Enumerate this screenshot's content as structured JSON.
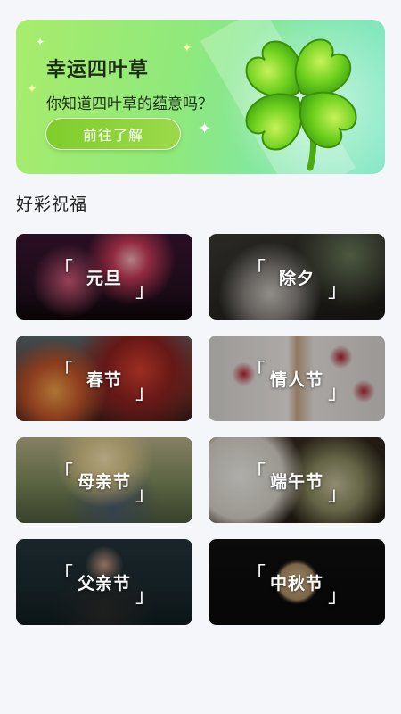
{
  "banner": {
    "title": "幸运四叶草",
    "subtitle": "你知道四叶草的蕴意吗？",
    "button_label": "前往了解"
  },
  "section": {
    "title": "好彩祝福"
  },
  "cards": [
    {
      "label": "元旦"
    },
    {
      "label": "除夕"
    },
    {
      "label": "春节"
    },
    {
      "label": "情人节"
    },
    {
      "label": "母亲节"
    },
    {
      "label": "端午节"
    },
    {
      "label": "父亲节"
    },
    {
      "label": "中秋节"
    }
  ],
  "colors": {
    "page_bg": "#f5f6fa",
    "banner_green": "#8fe97c",
    "button_green": "#8ad13c"
  }
}
